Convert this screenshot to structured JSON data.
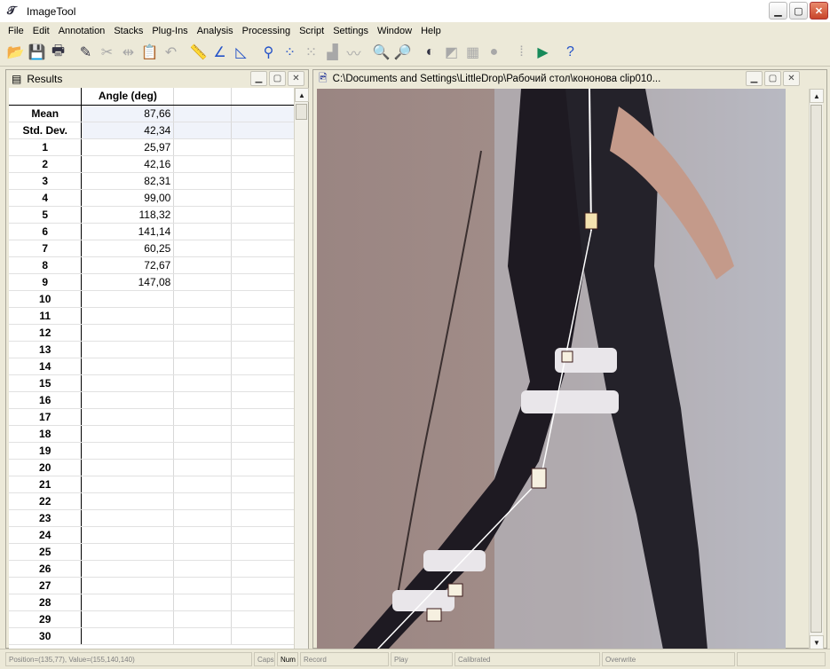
{
  "app": {
    "title": "ImageTool",
    "icon": "imagetool-app-icon"
  },
  "menu": [
    "File",
    "Edit",
    "Annotation",
    "Stacks",
    "Plug-Ins",
    "Analysis",
    "Processing",
    "Script",
    "Settings",
    "Window",
    "Help"
  ],
  "toolbar": [
    {
      "icon": "open-icon",
      "glyph": "📂"
    },
    {
      "icon": "save-icon",
      "glyph": "💾"
    },
    {
      "icon": "print-icon",
      "glyph": "🖶"
    },
    {
      "icon": "pencil-icon",
      "glyph": "✎"
    },
    {
      "icon": "cut-icon",
      "glyph": "✂"
    },
    {
      "icon": "flip-icon",
      "glyph": "⇹"
    },
    {
      "icon": "paste-icon",
      "glyph": "📋"
    },
    {
      "icon": "undo-icon",
      "glyph": "↶"
    },
    {
      "icon": "ruler-icon",
      "glyph": "📏"
    },
    {
      "icon": "angle-icon",
      "glyph": "∠"
    },
    {
      "icon": "triangle-icon",
      "glyph": "◺"
    },
    {
      "icon": "count-icon",
      "glyph": "⚲"
    },
    {
      "icon": "dots-icon",
      "glyph": "⁘"
    },
    {
      "icon": "scatter-icon",
      "glyph": "⁙"
    },
    {
      "icon": "histogram-icon",
      "glyph": "▟"
    },
    {
      "icon": "profile-icon",
      "glyph": "〰"
    },
    {
      "icon": "zoom-in-icon",
      "glyph": "🔍"
    },
    {
      "icon": "zoom-out-icon",
      "glyph": "🔎"
    },
    {
      "icon": "threshold-icon",
      "glyph": "◐"
    },
    {
      "icon": "contrast-icon",
      "glyph": "◩"
    },
    {
      "icon": "calculator-icon",
      "glyph": "▦"
    },
    {
      "icon": "blob-icon",
      "glyph": "●"
    },
    {
      "icon": "filter-icon",
      "glyph": "⁞"
    },
    {
      "icon": "play-icon",
      "glyph": "▶"
    },
    {
      "icon": "help-icon",
      "glyph": "?"
    }
  ],
  "results": {
    "title": "Results",
    "column_header": "Angle (deg)",
    "stats": [
      {
        "label": "Mean",
        "value": "87,66"
      },
      {
        "label": "Std. Dev.",
        "value": "42,34"
      }
    ],
    "rows": [
      {
        "label": "1",
        "value": "25,97"
      },
      {
        "label": "2",
        "value": "42,16"
      },
      {
        "label": "3",
        "value": "82,31"
      },
      {
        "label": "4",
        "value": "99,00"
      },
      {
        "label": "5",
        "value": "118,32"
      },
      {
        "label": "6",
        "value": "141,14"
      },
      {
        "label": "7",
        "value": "60,25"
      },
      {
        "label": "8",
        "value": "72,67"
      },
      {
        "label": "9",
        "value": "147,08"
      },
      {
        "label": "10",
        "value": ""
      },
      {
        "label": "11",
        "value": ""
      },
      {
        "label": "12",
        "value": ""
      },
      {
        "label": "13",
        "value": ""
      },
      {
        "label": "14",
        "value": ""
      },
      {
        "label": "15",
        "value": ""
      },
      {
        "label": "16",
        "value": ""
      },
      {
        "label": "17",
        "value": ""
      },
      {
        "label": "18",
        "value": ""
      },
      {
        "label": "19",
        "value": ""
      },
      {
        "label": "20",
        "value": ""
      },
      {
        "label": "21",
        "value": ""
      },
      {
        "label": "22",
        "value": ""
      },
      {
        "label": "23",
        "value": ""
      },
      {
        "label": "24",
        "value": ""
      },
      {
        "label": "25",
        "value": ""
      },
      {
        "label": "26",
        "value": ""
      },
      {
        "label": "27",
        "value": ""
      },
      {
        "label": "28",
        "value": ""
      },
      {
        "label": "29",
        "value": ""
      },
      {
        "label": "30",
        "value": ""
      }
    ]
  },
  "image_window": {
    "title": "C:\\Documents and Settings\\LittleDrop\\Рабочий стол\\кононова clip010..."
  },
  "status": {
    "position": "Position=(135,77), Value=(155,140,140)",
    "caps": "Caps",
    "num": "Num",
    "record": "Record",
    "play": "Play",
    "calibrated": "Calibrated",
    "overwrite": "Overwrite"
  }
}
